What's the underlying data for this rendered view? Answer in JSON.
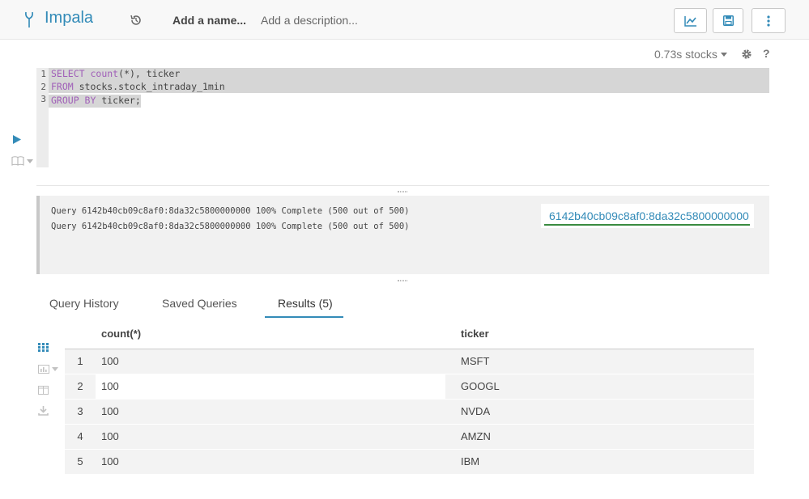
{
  "header": {
    "engine": "Impala",
    "name_placeholder": "Add a name...",
    "description_placeholder": "Add a description..."
  },
  "snippet": {
    "meta": "0.73s stocks",
    "help": "?",
    "gutter": [
      "1",
      "2",
      "3"
    ]
  },
  "log": {
    "lines": [
      "Query 6142b40cb09c8af0:8da32c5800000000 100% Complete (500 out of 500)",
      "Query 6142b40cb09c8af0:8da32c5800000000 100% Complete (500 out of 500)"
    ],
    "query_id": "6142b40cb09c8af0:8da32c5800000000"
  },
  "tabs": {
    "history": "Query History",
    "saved": "Saved Queries",
    "results": "Results (5)"
  },
  "table": {
    "columns": [
      "count(*)",
      "ticker"
    ],
    "rows": [
      {
        "n": "1",
        "count": "100",
        "ticker": "MSFT"
      },
      {
        "n": "2",
        "count": "100",
        "ticker": "GOOGL"
      },
      {
        "n": "3",
        "count": "100",
        "ticker": "NVDA"
      },
      {
        "n": "4",
        "count": "100",
        "ticker": "AMZN"
      },
      {
        "n": "5",
        "count": "100",
        "ticker": "IBM"
      }
    ]
  },
  "colors": {
    "accent": "#338bb8",
    "keyword": "#a05fb8",
    "link_underline": "#3a8b40"
  }
}
